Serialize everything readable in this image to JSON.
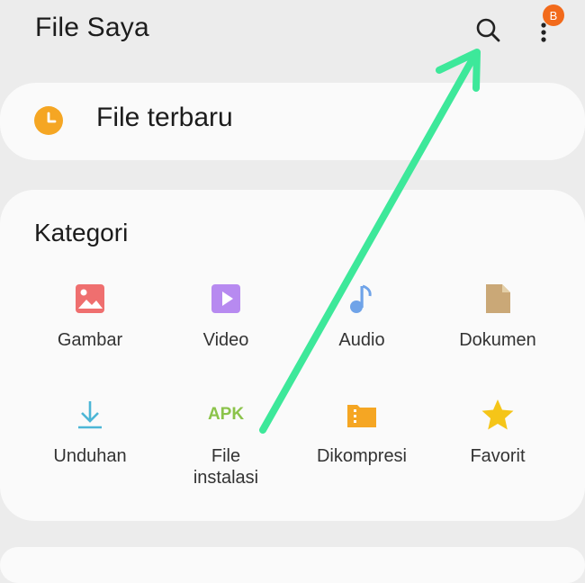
{
  "header": {
    "title": "File Saya",
    "badge": "B"
  },
  "recent": {
    "label": "File terbaru"
  },
  "categories": {
    "title": "Kategori",
    "items": [
      {
        "label": "Gambar",
        "icon": "image-icon",
        "color": "#ef6f6f"
      },
      {
        "label": "Video",
        "icon": "video-icon",
        "color": "#b78af0"
      },
      {
        "label": "Audio",
        "icon": "music-note-icon",
        "color": "#6fa3e8"
      },
      {
        "label": "Dokumen",
        "icon": "document-icon",
        "color": "#caa877"
      },
      {
        "label": "Unduhan",
        "icon": "download-icon",
        "color": "#4cb6d6"
      },
      {
        "label": "File\ninstalasi",
        "icon_text": "APK",
        "icon": "apk-icon",
        "color": "#8bc34a"
      },
      {
        "label": "Dikompresi",
        "icon": "archive-folder-icon",
        "color": "#f5a623"
      },
      {
        "label": "Favorit",
        "icon": "star-icon",
        "color": "#f5c518"
      }
    ]
  },
  "colors": {
    "accent_orange": "#f5a623",
    "annotation_arrow": "#3de89a",
    "badge": "#f26a1b"
  }
}
